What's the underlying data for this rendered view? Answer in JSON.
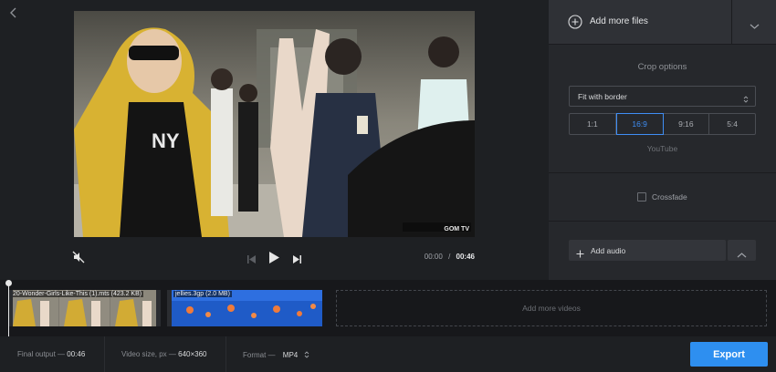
{
  "preview": {
    "time_current": "00:00",
    "time_separator": "/",
    "time_total": "00:46",
    "video_watermark": "GOM TV"
  },
  "panel": {
    "add_files_label": "Add more files",
    "crop_title": "Crop options",
    "crop_mode": "Fit with border",
    "ratios": [
      "1:1",
      "16:9",
      "9:16",
      "5:4"
    ],
    "active_ratio": "16:9",
    "ratio_hint": "YouTube",
    "crossfade_label": "Crossfade",
    "crossfade_checked": false,
    "add_audio_label": "Add audio"
  },
  "timeline": {
    "clips": [
      {
        "label": "20-Wonder-Girls-Like-This (1).mts (423.2 KB)"
      },
      {
        "label": "jellies.3gp (2.0 MB)"
      }
    ],
    "add_more_videos": "Add more videos"
  },
  "footer": {
    "final_output_label": "Final output —",
    "final_output_value": "00:46",
    "video_size_label": "Video size, px —",
    "video_size_value": "640×360",
    "format_label": "Format —",
    "format_value": "MP4",
    "export_label": "Export"
  },
  "colors": {
    "accent": "#2e8ff0",
    "active_ratio": "#3f8ef5",
    "background": "#1e2023",
    "panel": "#26282c"
  }
}
